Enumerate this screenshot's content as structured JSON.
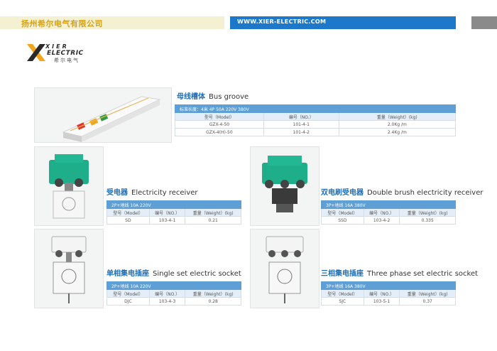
{
  "header": {
    "company": "扬州希尔电气有限公司",
    "website": "WWW.XIER-ELECTRIC.COM"
  },
  "logo": {
    "brand_top": "XIER",
    "brand_main": "ELECTRIC",
    "brand_cn": "希尔电气"
  },
  "colors": {
    "header_yellow_bg": "#f4f0d2",
    "header_yellow_text": "#d8a214",
    "header_blue": "#1d78c9",
    "table_band": "#5e9fd6",
    "title_blue": "#1f6fb8"
  },
  "products": {
    "bus_groove": {
      "title_cn": "母线槽体",
      "title_en": "Bus groove",
      "spec": "标准长度：4米  4P  50A  220V  380V",
      "headers": [
        "型号（Model）",
        "编号（NO.）",
        "重量（Weight）(kg)"
      ],
      "rows": [
        [
          "GZX-4-50",
          "101-4-1",
          "2.0Kg /m"
        ],
        [
          "GZX-4(H)-50",
          "101-4-2",
          "2.4Kg /m"
        ]
      ]
    },
    "receiver": {
      "title_cn": "受电器",
      "title_en": "Electricity receiver",
      "spec": "2P+地线  10A  220V",
      "headers": [
        "型号（Model）",
        "编号（NO.）",
        "重量（Weight）(kg)"
      ],
      "rows": [
        [
          "SD",
          "103-4-1",
          "0.21"
        ]
      ]
    },
    "double_brush": {
      "title_cn": "双电刷受电器",
      "title_en": "Double brush electricity receiver",
      "spec": "3P+地线  16A  380V",
      "headers": [
        "型号（Model）",
        "编号（NO.）",
        "重量（Weight）(kg)"
      ],
      "rows": [
        [
          "SSD",
          "103-4-2",
          "0.335"
        ]
      ]
    },
    "single_socket": {
      "title_cn": "单相集电插座",
      "title_en": "Single set electric socket",
      "spec": "2P+地线  10A  220V",
      "headers": [
        "型号（Model）",
        "编号（NO.）",
        "重量（Weight）(kg)"
      ],
      "rows": [
        [
          "DJC",
          "103-4-3",
          "0.28"
        ]
      ]
    },
    "three_phase_socket": {
      "title_cn": "三相集电插座",
      "title_en": "Three phase set electric socket",
      "spec": "3P+地线  16A  380V",
      "headers": [
        "型号（Model）",
        "编号（NO.）",
        "重量（Weight）(kg)"
      ],
      "rows": [
        [
          "SJC",
          "103-5-1",
          "0.37"
        ]
      ]
    }
  }
}
